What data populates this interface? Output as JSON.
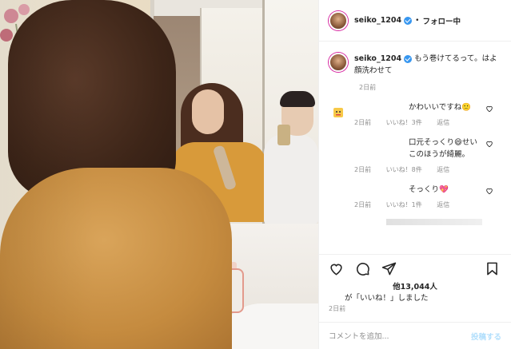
{
  "header": {
    "username": "seiko_1204",
    "separator": "•",
    "follow_status": "フォロー中"
  },
  "caption": {
    "username": "seiko_1204",
    "text": "もう巻けてるって。はよ顔洗わせて",
    "time": "2日前"
  },
  "comments": [
    {
      "text": "かわいいですね🙂",
      "time": "2日前",
      "likes": "いいね！3件",
      "reply": "返信",
      "avatar_icon": "emoji-avatar-icon"
    },
    {
      "text": "口元そっくり😄せいこのほうが綺麗。",
      "time": "2日前",
      "likes": "いいね！8件",
      "reply": "返信",
      "avatar_icon": "blank-avatar-icon"
    },
    {
      "text": "そっくり💖",
      "time": "2日前",
      "likes": "いいね！1件",
      "reply": "返信",
      "avatar_icon": "blank-avatar-icon"
    }
  ],
  "actions": {
    "like_count": "他13,044人",
    "liked_by_text": "が「いいね！」しました",
    "post_time": "2日前"
  },
  "comment_box": {
    "placeholder": "コメントを追加...",
    "post_label": "投稿する"
  },
  "colors": {
    "verified": "#3897f0",
    "muted": "#8e8e8e",
    "post_disabled": "#b2dffc"
  }
}
